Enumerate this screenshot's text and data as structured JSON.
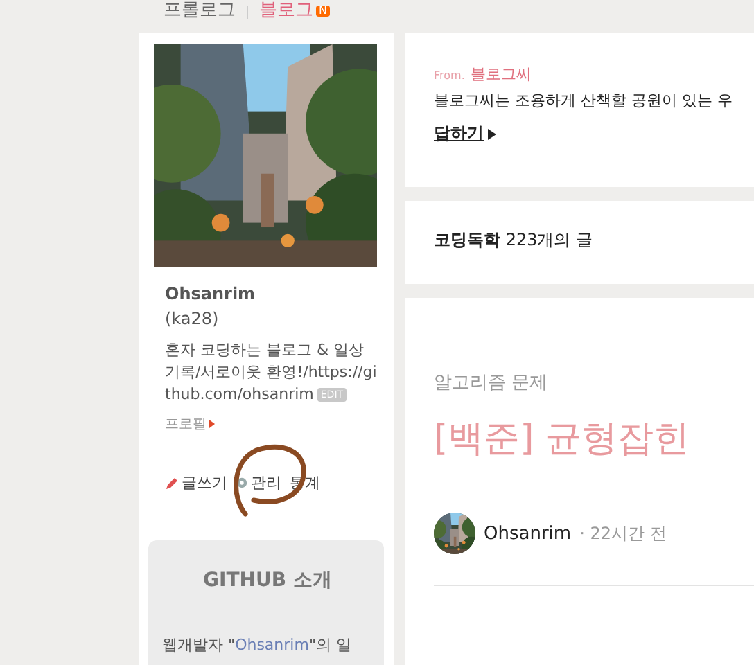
{
  "top_nav": {
    "items": [
      {
        "label": "프롤로그",
        "selected": false
      },
      {
        "label": "블로그",
        "selected": true,
        "badge": "N"
      }
    ]
  },
  "profile": {
    "name": "Ohsanrim",
    "id": "(ka28)",
    "description": "혼자 코딩하는 블로그 & 일상 기록/서로이웃 환영!/https://github.com/ohsanrim",
    "edit_badge": "EDIT",
    "profile_link": "프로필",
    "actions": [
      {
        "kind": "write",
        "label": "글쓰기"
      },
      {
        "kind": "manage",
        "label": "관리"
      },
      {
        "kind": "stats",
        "label": "통계"
      }
    ]
  },
  "widget": {
    "title": "GITHUB 소개",
    "text_before": "웹개발자 \"",
    "link": "Ohsanrim",
    "text_after": "\"의 일"
  },
  "blogger_question": {
    "from_label": "From.",
    "from_name": "블로그씨",
    "question": "블로그씨는 조용하게 산책할 공원이 있는 우",
    "reply": "답하기"
  },
  "category": {
    "name": "코딩독학",
    "count": "223개의 글"
  },
  "post": {
    "category": "알고리즘 문제",
    "title": "[백준] 균형잡힌",
    "author": "Ohsanrim",
    "time": "· 22시간 전"
  }
}
